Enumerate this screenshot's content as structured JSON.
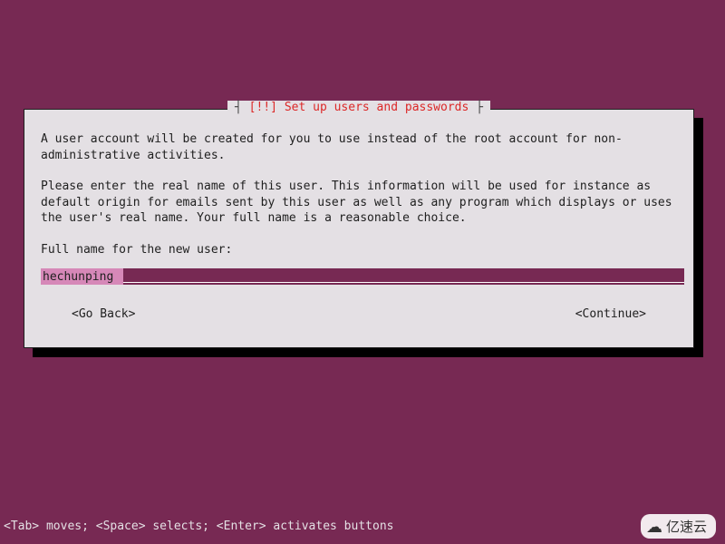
{
  "dialog": {
    "title_prefix": "┤ ",
    "title": "[!!] Set up users and passwords",
    "title_suffix": " ├",
    "para1": "A user account will be created for you to use instead of the root account for non-administrative activities.",
    "para2": "Please enter the real name of this user. This information will be used for instance as default origin for emails sent by this user as well as any program which displays or uses the user's real name. Your full name is a reasonable choice.",
    "prompt": "Full name for the new user:",
    "input_value": "hechunping",
    "back_label": "<Go Back>",
    "continue_label": "<Continue>"
  },
  "help_bar": "<Tab> moves; <Space> selects; <Enter> activates buttons",
  "watermark": "亿速云"
}
